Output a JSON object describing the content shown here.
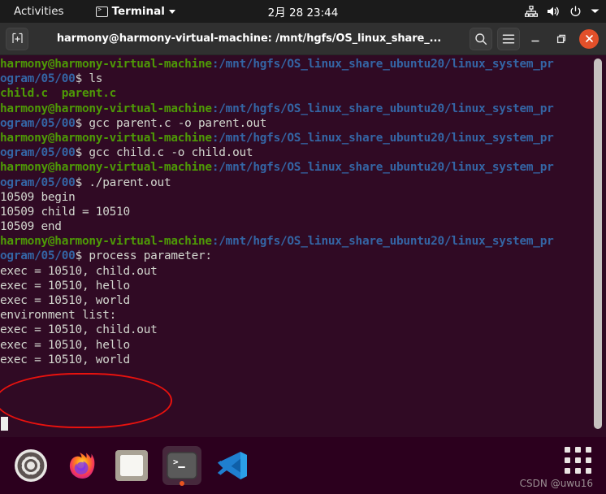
{
  "top_panel": {
    "activities": "Activities",
    "app_menu": {
      "name": "Terminal",
      "icon": "terminal-icon"
    },
    "clock": "2月 28  23:44",
    "system_icons": [
      "network-wired-icon",
      "volume-icon",
      "power-icon",
      "chevron-down-icon"
    ]
  },
  "window": {
    "title": "harmony@harmony-virtual-machine: /mnt/hgfs/OS_linux_share_...",
    "new_tab_icon": "new-tab-icon",
    "buttons": {
      "search": "search-icon",
      "menu": "hamburger-menu-icon",
      "minimize": "minimize-icon",
      "maximize": "maximize-icon",
      "close": "close-icon"
    },
    "close_color": "#e2502a"
  },
  "terminal": {
    "background": "#300a24",
    "prompt_user": "harmony@harmony-virtual-machine",
    "prompt_user_color": "#4e9a06",
    "prompt_path_color": "#3465a4",
    "text_color": "#d3d7cf",
    "lines": [
      {
        "type": "prompt",
        "user": "harmony@harmony-virtual-machine",
        "path": ":/mnt/hgfs/OS_linux_share_ubuntu20/linux_system_pr"
      },
      {
        "type": "prompt_cont",
        "path": "ogram/05/00",
        "command": "$ ls"
      },
      {
        "type": "green",
        "text": "child.c  parent.c"
      },
      {
        "type": "prompt",
        "user": "harmony@harmony-virtual-machine",
        "path": ":/mnt/hgfs/OS_linux_share_ubuntu20/linux_system_pr"
      },
      {
        "type": "prompt_cont",
        "path": "ogram/05/00",
        "command": "$ gcc parent.c -o parent.out"
      },
      {
        "type": "prompt",
        "user": "harmony@harmony-virtual-machine",
        "path": ":/mnt/hgfs/OS_linux_share_ubuntu20/linux_system_pr"
      },
      {
        "type": "prompt_cont",
        "path": "ogram/05/00",
        "command": "$ gcc child.c -o child.out"
      },
      {
        "type": "prompt",
        "user": "harmony@harmony-virtual-machine",
        "path": ":/mnt/hgfs/OS_linux_share_ubuntu20/linux_system_pr"
      },
      {
        "type": "prompt_cont",
        "path": "ogram/05/00",
        "command": "$ ./parent.out"
      },
      {
        "type": "out",
        "text": "10509 begin"
      },
      {
        "type": "out",
        "text": "10509 child = 10510"
      },
      {
        "type": "out",
        "text": "10509 end"
      },
      {
        "type": "prompt",
        "user": "harmony@harmony-virtual-machine",
        "path": ":/mnt/hgfs/OS_linux_share_ubuntu20/linux_system_pr"
      },
      {
        "type": "prompt_cont",
        "path": "ogram/05/00",
        "command": "$ process parameter:"
      },
      {
        "type": "out",
        "text": "exec = 10510, child.out"
      },
      {
        "type": "out",
        "text": "exec = 10510, hello"
      },
      {
        "type": "out",
        "text": "exec = 10510, world"
      },
      {
        "type": "out",
        "text": "environment list:"
      },
      {
        "type": "out",
        "text": "exec = 10510, child.out"
      },
      {
        "type": "out",
        "text": "exec = 10510, hello"
      },
      {
        "type": "out",
        "text": "exec = 10510, world"
      }
    ],
    "annotation": {
      "shape": "ellipse",
      "color": "#e8120e",
      "covers": "last three exec lines"
    },
    "scrollbar": {
      "thumb_color": "#c6c2c0"
    }
  },
  "dock": {
    "items": [
      {
        "name": "settings",
        "icon": "gear-icon",
        "active": false,
        "running": false
      },
      {
        "name": "firefox",
        "icon": "firefox-icon",
        "active": false,
        "running": false
      },
      {
        "name": "files",
        "icon": "folder-icon",
        "active": false,
        "running": false
      },
      {
        "name": "terminal",
        "icon": "terminal-icon",
        "active": true,
        "running": true
      },
      {
        "name": "vscode",
        "icon": "vscode-icon",
        "active": false,
        "running": false
      }
    ],
    "app_grid": "show-applications-icon"
  },
  "watermark": "CSDN @uwu16"
}
